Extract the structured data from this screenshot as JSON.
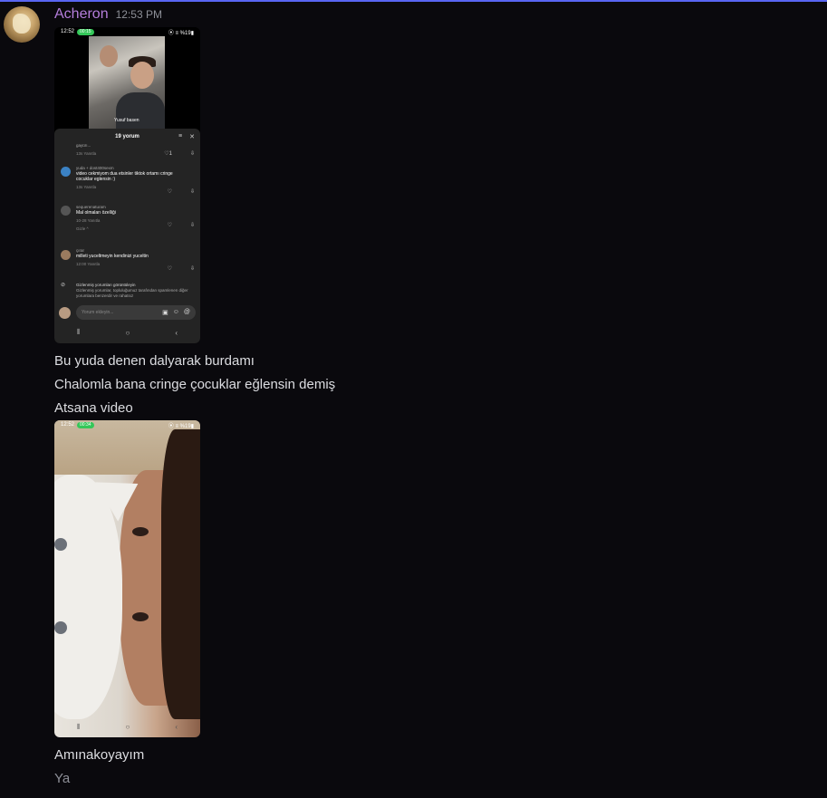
{
  "message": {
    "username": "Acheron",
    "timestamp": "12:53 PM"
  },
  "screenshot1": {
    "status_time": "12:52",
    "status_call": "00:15",
    "status_right": "⦿ ≡ %19▮",
    "video_caption": "Yusuf basen",
    "panel_title": "19 yorum",
    "comments": [
      {
        "name": "gayürı...",
        "text": "",
        "meta": "13s  Yanıtla",
        "likes": "1"
      },
      {
        "name": "yuda + dost400sexm",
        "text": "video cekmiyom dua etsinler tiktok ortamı cringe cocuklar eglensin :)",
        "meta": "13s  Yanıtla",
        "likes": ""
      },
      {
        "name": "sequerenaturam",
        "text": "Mal olmaları özelliği",
        "meta": "10-28  Yanıtla",
        "likes": ""
      },
      {
        "name": "çırar",
        "text": "milleti yuceltmeyin kendinizi yuceltin",
        "meta": "12:00  Yanıtla",
        "likes": ""
      }
    ],
    "hide_link": "Gizle ^",
    "hidden_title": "Gizlenmiş yorumları görüntüleyin",
    "hidden_desc": "Gizlenmiş yorumlar, topluluğumuz tarafından spamlenen diğer yorumlara benzerdir ve rahatsız",
    "comment_placeholder": "Yorum ekleyin..."
  },
  "lines": [
    "Bu yuda denen dalyarak burdamı",
    "Chalomla bana cringe çocuklar eğlensin demiş",
    "Atsana video"
  ],
  "screenshot2": {
    "status_time": "12:52",
    "status_call": "00:34",
    "status_right": "⦿ ≡ %19▮"
  },
  "lines_after": [
    "Amınakoyayım",
    "Ya"
  ]
}
